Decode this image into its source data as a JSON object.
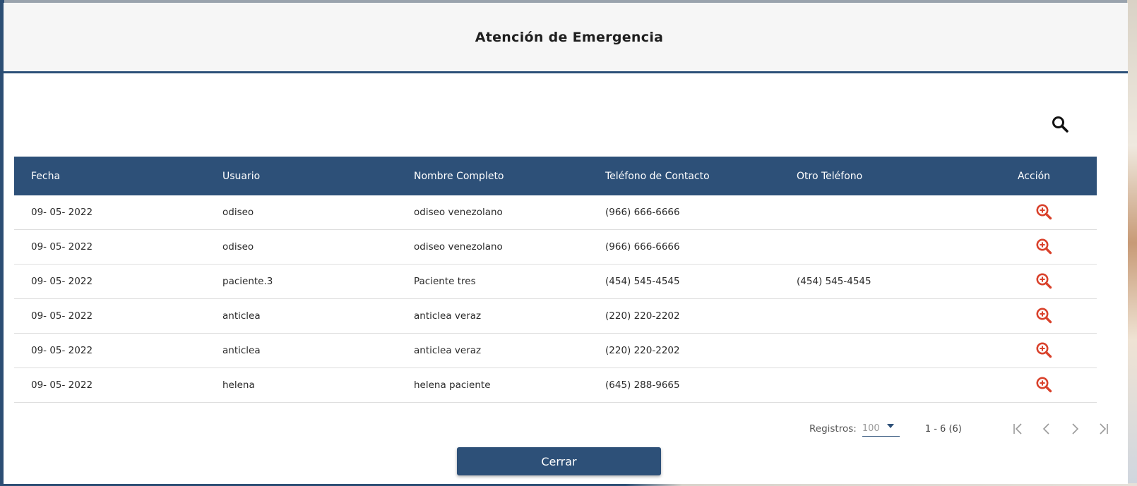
{
  "modal": {
    "title": "Atención de Emergencia",
    "close_label": "Cerrar"
  },
  "search": {
    "icon": "search-icon"
  },
  "table": {
    "columns": [
      "Fecha",
      "Usuario",
      "Nombre Completo",
      "Teléfono de Contacto",
      "Otro Teléfono",
      "Acción"
    ],
    "rows": [
      {
        "fecha": "09- 05- 2022",
        "usuario": "odiseo",
        "nombre": "odiseo venezolano",
        "telefono": "(966) 666-6666",
        "otro": ""
      },
      {
        "fecha": "09- 05- 2022",
        "usuario": "odiseo",
        "nombre": "odiseo venezolano",
        "telefono": "(966) 666-6666",
        "otro": ""
      },
      {
        "fecha": "09- 05- 2022",
        "usuario": "paciente.3",
        "nombre": "Paciente tres",
        "telefono": "(454) 545-4545",
        "otro": "(454) 545-4545"
      },
      {
        "fecha": "09- 05- 2022",
        "usuario": "anticlea",
        "nombre": "anticlea veraz",
        "telefono": "(220) 220-2202",
        "otro": ""
      },
      {
        "fecha": "09- 05- 2022",
        "usuario": "anticlea",
        "nombre": "anticlea veraz",
        "telefono": "(220) 220-2202",
        "otro": ""
      },
      {
        "fecha": "09- 05- 2022",
        "usuario": "helena",
        "nombre": "helena paciente",
        "telefono": "(645) 288-9665",
        "otro": ""
      }
    ],
    "action_icon": "zoom-in-icon",
    "action_color": "#d9412b"
  },
  "pager": {
    "label": "Registros:",
    "page_size": "100",
    "range": "1 - 6 (6)"
  },
  "colors": {
    "primary": "#2d5078",
    "header_bg": "#f6f6f6"
  }
}
